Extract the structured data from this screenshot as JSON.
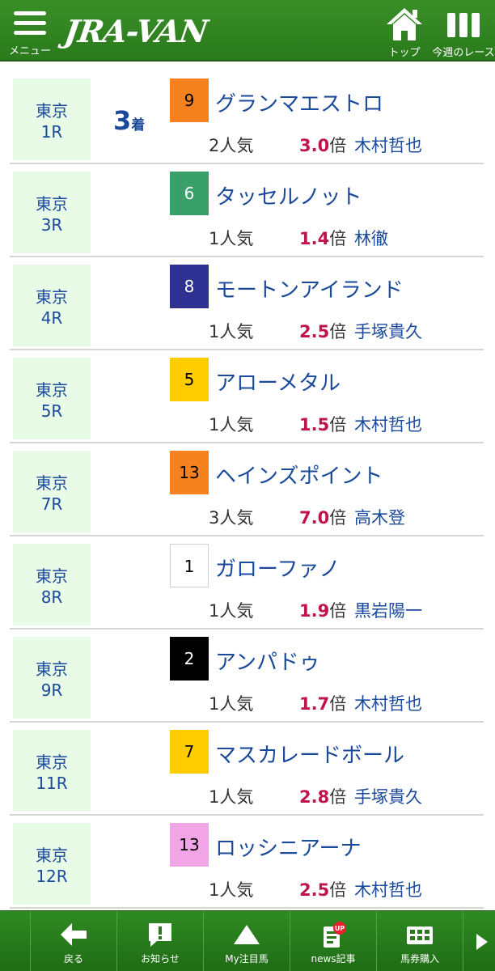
{
  "header": {
    "menu_label": "メニュー",
    "logo_text": "JRA-VAN",
    "top_label": "トップ",
    "week_races_label": "今週のレース",
    "background_color": "#2a7a1c"
  },
  "results": [
    {
      "venue": "東京",
      "race": "1R",
      "place": "3",
      "place_unit": "着",
      "number": "9",
      "badge_color": "#f5821f",
      "badge_text_color": "#000000",
      "horse": "グランマエストロ",
      "popularity": "2人気",
      "odds": "3.0",
      "odds_unit": "倍",
      "jockey": "木村哲也"
    },
    {
      "venue": "東京",
      "race": "3R",
      "place": "",
      "place_unit": "",
      "number": "6",
      "badge_color": "#3aa06a",
      "badge_text_color": "#ffffff",
      "horse": "タッセルノット",
      "popularity": "1人気",
      "odds": "1.4",
      "odds_unit": "倍",
      "jockey": "林徹"
    },
    {
      "venue": "東京",
      "race": "4R",
      "place": "",
      "place_unit": "",
      "number": "8",
      "badge_color": "#2e3192",
      "badge_text_color": "#ffffff",
      "horse": "モートンアイランド",
      "popularity": "1人気",
      "odds": "2.5",
      "odds_unit": "倍",
      "jockey": "手塚貴久"
    },
    {
      "venue": "東京",
      "race": "5R",
      "place": "",
      "place_unit": "",
      "number": "5",
      "badge_color": "#ffcc00",
      "badge_text_color": "#000000",
      "horse": "アローメタル",
      "popularity": "1人気",
      "odds": "1.5",
      "odds_unit": "倍",
      "jockey": "木村哲也"
    },
    {
      "venue": "東京",
      "race": "7R",
      "place": "",
      "place_unit": "",
      "number": "13",
      "badge_color": "#f5821f",
      "badge_text_color": "#000000",
      "horse": "ヘインズポイント",
      "popularity": "3人気",
      "odds": "7.0",
      "odds_unit": "倍",
      "jockey": "高木登"
    },
    {
      "venue": "東京",
      "race": "8R",
      "place": "",
      "place_unit": "",
      "number": "1",
      "badge_color": "#ffffff",
      "badge_text_color": "#000000",
      "horse": "ガローファノ",
      "popularity": "1人気",
      "odds": "1.9",
      "odds_unit": "倍",
      "jockey": "黒岩陽一"
    },
    {
      "venue": "東京",
      "race": "9R",
      "place": "",
      "place_unit": "",
      "number": "2",
      "badge_color": "#000000",
      "badge_text_color": "#ffffff",
      "horse": "アンパドゥ",
      "popularity": "1人気",
      "odds": "1.7",
      "odds_unit": "倍",
      "jockey": "木村哲也"
    },
    {
      "venue": "東京",
      "race": "11R",
      "place": "",
      "place_unit": "",
      "number": "7",
      "badge_color": "#ffcc00",
      "badge_text_color": "#000000",
      "horse": "マスカレードボール",
      "popularity": "1人気",
      "odds": "2.8",
      "odds_unit": "倍",
      "jockey": "手塚貴久"
    },
    {
      "venue": "東京",
      "race": "12R",
      "place": "",
      "place_unit": "",
      "number": "13",
      "badge_color": "#f2a5e6",
      "badge_text_color": "#000000",
      "horse": "ロッシニアーナ",
      "popularity": "1人気",
      "odds": "2.5",
      "odds_unit": "倍",
      "jockey": "木村哲也"
    }
  ],
  "footer": {
    "back_label": "戻る",
    "info_label": "お知らせ",
    "fav_label": "My注目馬",
    "news_label": "news記事",
    "news_badge": "UP",
    "bet_label": "馬券購入"
  },
  "colors": {
    "accent_green": "#2a7a1c",
    "venue_bg": "#e8fbe6",
    "text_blue": "#1b4a9a",
    "odds_red": "#c0144a"
  }
}
